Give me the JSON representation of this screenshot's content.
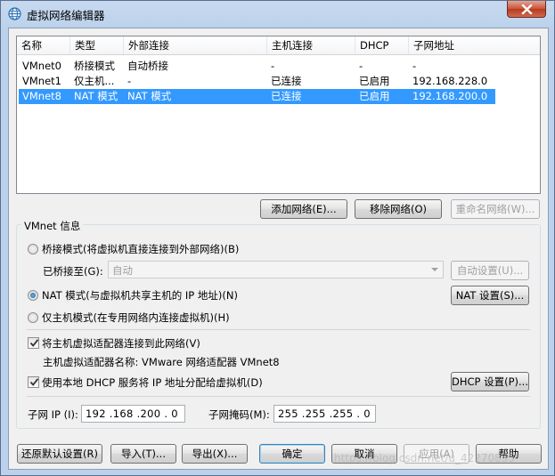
{
  "window": {
    "title": "虚拟网络编辑器",
    "app_icon": "network-globe-icon",
    "close_icon": "close-icon"
  },
  "network_list": {
    "columns": [
      "名称",
      "类型",
      "外部连接",
      "主机连接",
      "DHCP",
      "子网地址"
    ],
    "rows": [
      {
        "name": "VMnet0",
        "type": "桥接模式",
        "external": "自动桥接",
        "host": "-",
        "dhcp": "-",
        "subnet": "-"
      },
      {
        "name": "VMnet1",
        "type": "仅主机...",
        "external": "-",
        "host": "已连接",
        "dhcp": "已启用",
        "subnet": "192.168.228.0"
      },
      {
        "name": "VMnet8",
        "type": "NAT 模式",
        "external": "NAT 模式",
        "host": "已连接",
        "dhcp": "已启用",
        "subnet": "192.168.200.0"
      }
    ],
    "selected_row": "VMnet8"
  },
  "list_buttons": {
    "add": "添加网络(E)...",
    "remove": "移除网络(O)",
    "rename": "重命名网络(W)..."
  },
  "vmnet_info": {
    "group_label": "VMnet 信息",
    "bridged_radio": "桥接模式(将虚拟机直接连接到外部网络)(B)",
    "bridged_to_label": "已桥接至(G):",
    "bridged_to_value": "自动",
    "auto_settings": "自动设置(U)...",
    "nat_radio": "NAT 模式(与虚拟机共享主机的 IP 地址)(N)",
    "nat_settings": "NAT 设置(S)...",
    "host_only_radio": "仅主机模式(在专用网络内连接虚拟机)(H)",
    "selected_mode": "nat",
    "connect_adapter_check": "将主机虚拟适配器连接到此网络(V)",
    "connect_adapter_checked": true,
    "adapter_name_text": "主机虚拟适配器名称: VMware 网络适配器 VMnet8",
    "dhcp_check": "使用本地 DHCP 服务将 IP 地址分配给虚拟机(D)",
    "dhcp_checked": true,
    "dhcp_settings": "DHCP 设置(P)...",
    "subnet_ip_label": "子网 IP (I):",
    "subnet_ip_value": "192 .168 .200 . 0",
    "subnet_mask_label": "子网掩码(M):",
    "subnet_mask_value": "255 .255 .255 . 0"
  },
  "footer_buttons": {
    "restore": "还原默认设置(R)",
    "import": "导入(T)...",
    "export": "导出(X)...",
    "ok": "确定",
    "cancel": "取消",
    "apply": "应用(A)",
    "help": "帮助"
  },
  "watermark": "https://blog.csdn.net/u_42270855"
}
